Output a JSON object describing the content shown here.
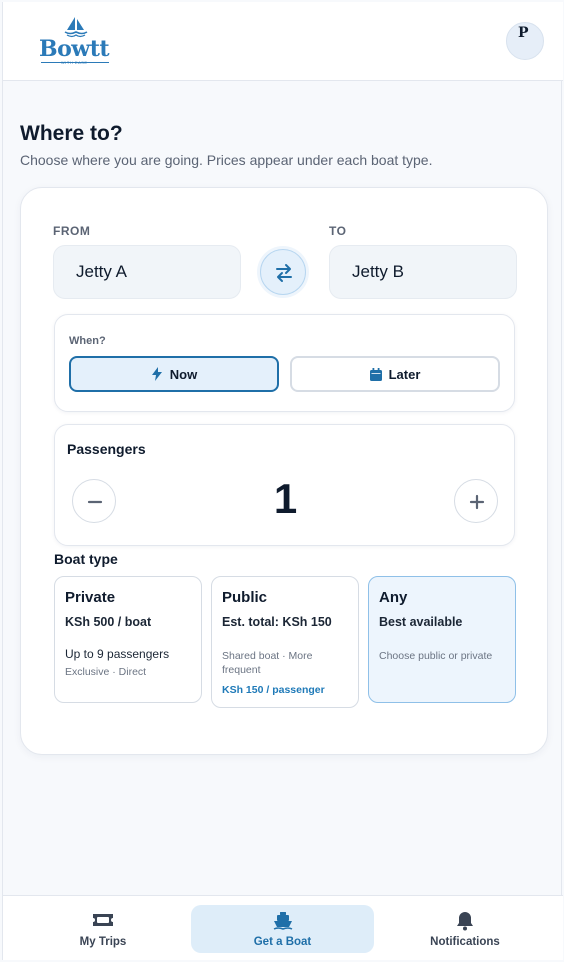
{
  "header": {
    "brand": "Bowtt",
    "tagline": "WITH EASE",
    "avatar_initial": "P"
  },
  "page": {
    "title": "Where to?",
    "subtitle": "Choose where you are going. Prices appear under each boat type."
  },
  "route": {
    "from_label": "FROM",
    "from_value": "Jetty A",
    "to_label": "TO",
    "to_value": "Jetty B"
  },
  "when": {
    "label": "When?",
    "options": [
      {
        "label": "Now",
        "selected": true
      },
      {
        "label": "Later",
        "selected": false
      }
    ]
  },
  "passengers": {
    "label": "Passengers",
    "count": "1"
  },
  "boat_type": {
    "label": "Boat type",
    "options": [
      {
        "name": "Private",
        "price": "KSh 500 / boat",
        "line1": "Up to 9 passengers",
        "detail": "Exclusive · Direct",
        "selected": false
      },
      {
        "name": "Public",
        "price": "Est. total: KSh 150",
        "detail": "Shared boat · More frequent",
        "note": "KSh 150 / passenger",
        "selected": false
      },
      {
        "name": "Any",
        "price": "Best available",
        "detail": "Choose public or private",
        "selected": true
      }
    ]
  },
  "nav": {
    "items": [
      {
        "label": "My Trips",
        "icon": "ticket-icon",
        "active": false
      },
      {
        "label": "Get a Boat",
        "icon": "boat-icon",
        "active": true
      },
      {
        "label": "Notifications",
        "icon": "bell-icon",
        "active": false
      }
    ]
  },
  "colors": {
    "accent": "#1f6fa8",
    "brand": "#2b7ab8",
    "selected_bg": "#e4f0fb"
  }
}
